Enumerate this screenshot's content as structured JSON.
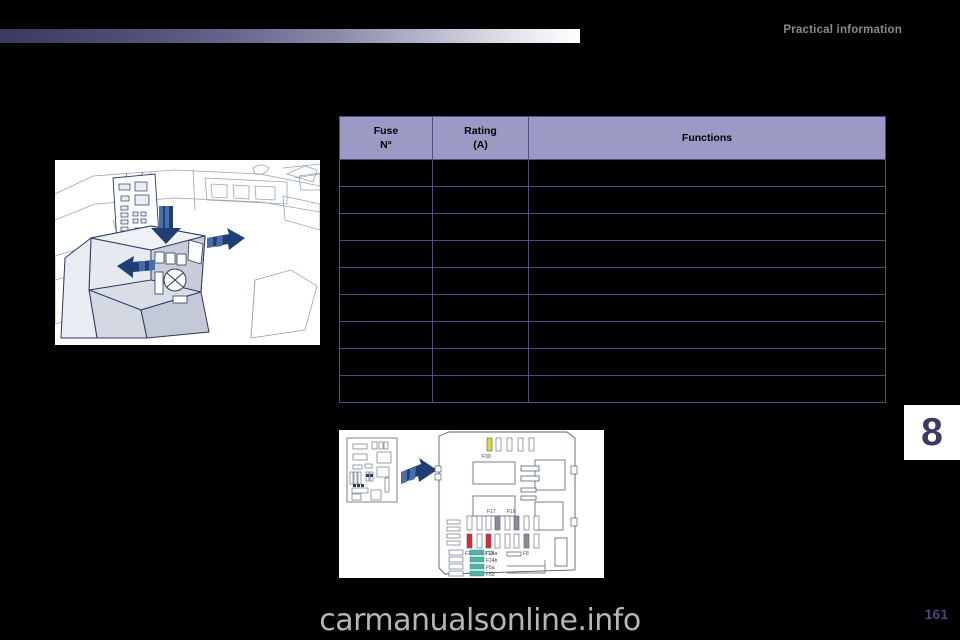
{
  "header": {
    "title": "Practical information",
    "band_gradient_start": "#3b3b5f",
    "band_gradient_end": "#ffffff"
  },
  "chapter": {
    "number": "8",
    "color": "#3d3a63"
  },
  "figures": {
    "cabin": {
      "name": "centre-console-fuse-box-location",
      "caption": ""
    },
    "fusebox": {
      "name": "dashboard-fuse-box-layout",
      "caption": "",
      "fuse_labels": [
        "F30",
        "F17",
        "F16",
        "F14",
        "F13",
        "F8",
        "F24a",
        "F24b",
        "F5a",
        "F5b"
      ],
      "fuse_colors": {
        "yellow": "#d8d93a",
        "red": "#d92b2b",
        "grey": "#8a8a9a",
        "teal": "#4fb3a6",
        "white": "#ffffff"
      }
    }
  },
  "table": {
    "columns": [
      {
        "line1": "Fuse",
        "line2": "N°"
      },
      {
        "line1": "Rating",
        "line2": "(A)"
      },
      {
        "line1": "Functions",
        "line2": ""
      }
    ],
    "rows": [
      {
        "fuse": "",
        "rating": "",
        "functions": ""
      },
      {
        "fuse": "",
        "rating": "",
        "functions": ""
      },
      {
        "fuse": "",
        "rating": "",
        "functions": ""
      },
      {
        "fuse": "",
        "rating": "",
        "functions": ""
      },
      {
        "fuse": "",
        "rating": "",
        "functions": ""
      },
      {
        "fuse": "",
        "rating": "",
        "functions": ""
      },
      {
        "fuse": "",
        "rating": "",
        "functions": ""
      },
      {
        "fuse": "",
        "rating": "",
        "functions": ""
      },
      {
        "fuse": "",
        "rating": "",
        "functions": ""
      }
    ],
    "header_bg": "#9a9ac4",
    "border_color": "#4e4c80"
  },
  "footer": {
    "watermark": "carmanualsonline.info",
    "page_number": "161"
  }
}
